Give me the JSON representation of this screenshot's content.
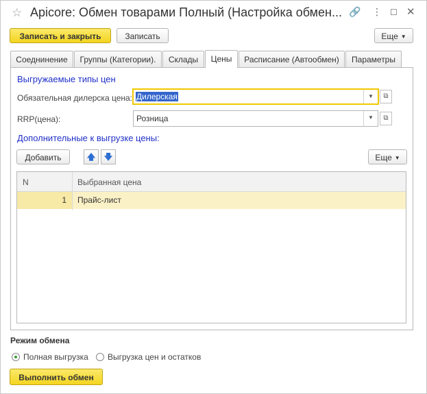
{
  "window": {
    "title": "Apicore: Обмен товарами Полный (Настройка обмен..."
  },
  "icons": {
    "star": "star-icon",
    "link": "link-icon",
    "more": "more-vertical-icon",
    "maximize": "maximize-icon",
    "close": "close-icon"
  },
  "toolbar": {
    "save_close_label": "Записать и закрыть",
    "save_label": "Записать",
    "more_label": "Еще"
  },
  "tabs": [
    {
      "label": "Соеднинение",
      "active": false
    },
    {
      "label": "Группы (Категории).",
      "active": false
    },
    {
      "label": "Склады",
      "active": false
    },
    {
      "label": "Цены",
      "active": true
    },
    {
      "label": "Расписание (Автообмен)",
      "active": false
    },
    {
      "label": "Параметры",
      "active": false
    }
  ],
  "prices": {
    "section_title": "Выгружаемые типы цен",
    "dealer_label": "Обязательная дилерска цена:",
    "dealer_value": "Дилерская",
    "rrp_label": "RRP(цена):",
    "rrp_value": "Розница",
    "additional_title": "Дополнительные к выгрузке цены:",
    "add_label": "Добавить",
    "more_label": "Еще"
  },
  "table": {
    "columns": [
      "N",
      "Выбранная цена"
    ],
    "rows": [
      {
        "n": "1",
        "price": "Прайс-лист"
      }
    ]
  },
  "mode": {
    "title": "Режим обмена",
    "options": [
      {
        "label": "Полная выгрузка",
        "selected": true
      },
      {
        "label": "Выгрузка цен и остатков",
        "selected": false
      }
    ],
    "run_label": "Выполнить обмен"
  },
  "colors": {
    "accent_yellow": "#f3d520",
    "section_blue": "#2030c8",
    "row_highlight": "#fbf1c6"
  }
}
